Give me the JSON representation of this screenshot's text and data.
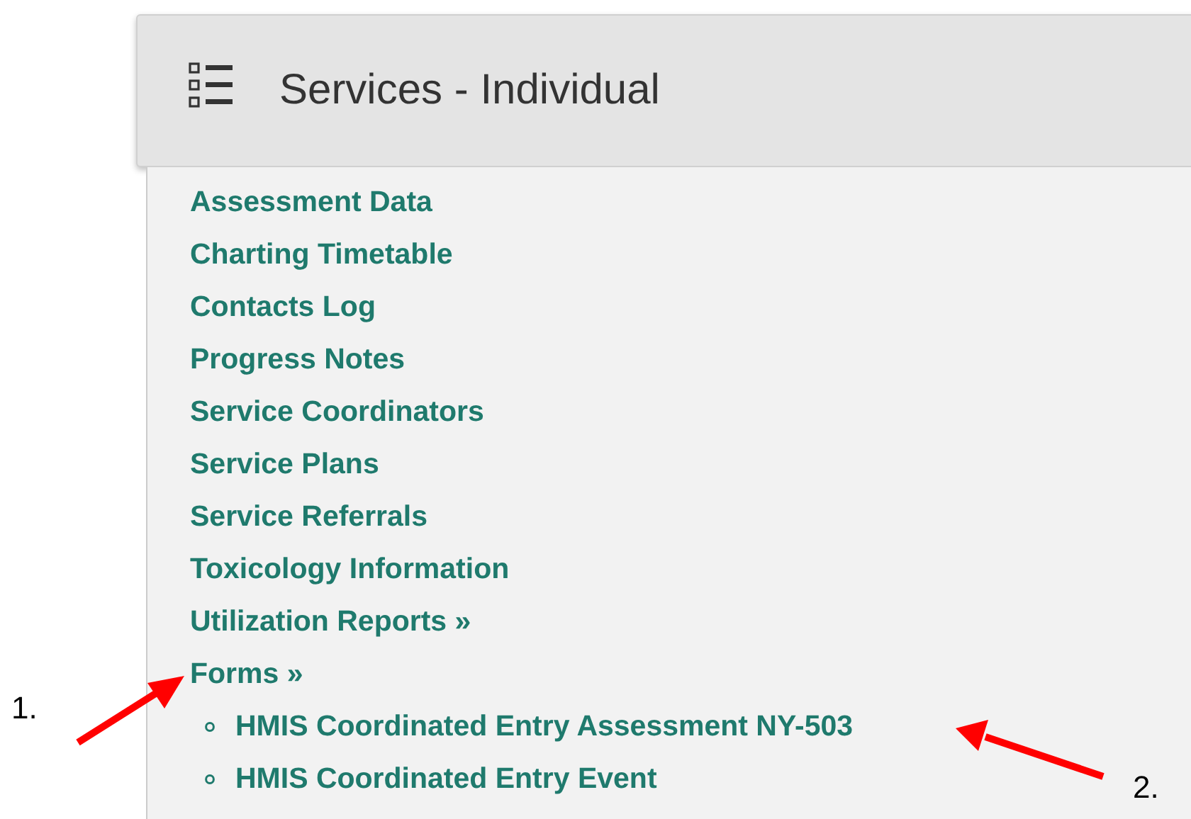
{
  "panel": {
    "title": "Services - Individual"
  },
  "menu": {
    "items": [
      {
        "label": "Assessment Data"
      },
      {
        "label": "Charting Timetable"
      },
      {
        "label": "Contacts Log"
      },
      {
        "label": "Progress Notes"
      },
      {
        "label": "Service Coordinators"
      },
      {
        "label": "Service Plans"
      },
      {
        "label": "Service Referrals"
      },
      {
        "label": "Toxicology Information"
      },
      {
        "label": "Utilization Reports »"
      },
      {
        "label": "Forms »",
        "children": [
          {
            "label": "HMIS Coordinated Entry Assessment NY-503"
          },
          {
            "label": "HMIS Coordinated Entry Event"
          }
        ]
      }
    ]
  },
  "annotations": [
    {
      "label": "1."
    },
    {
      "label": "2."
    }
  ]
}
